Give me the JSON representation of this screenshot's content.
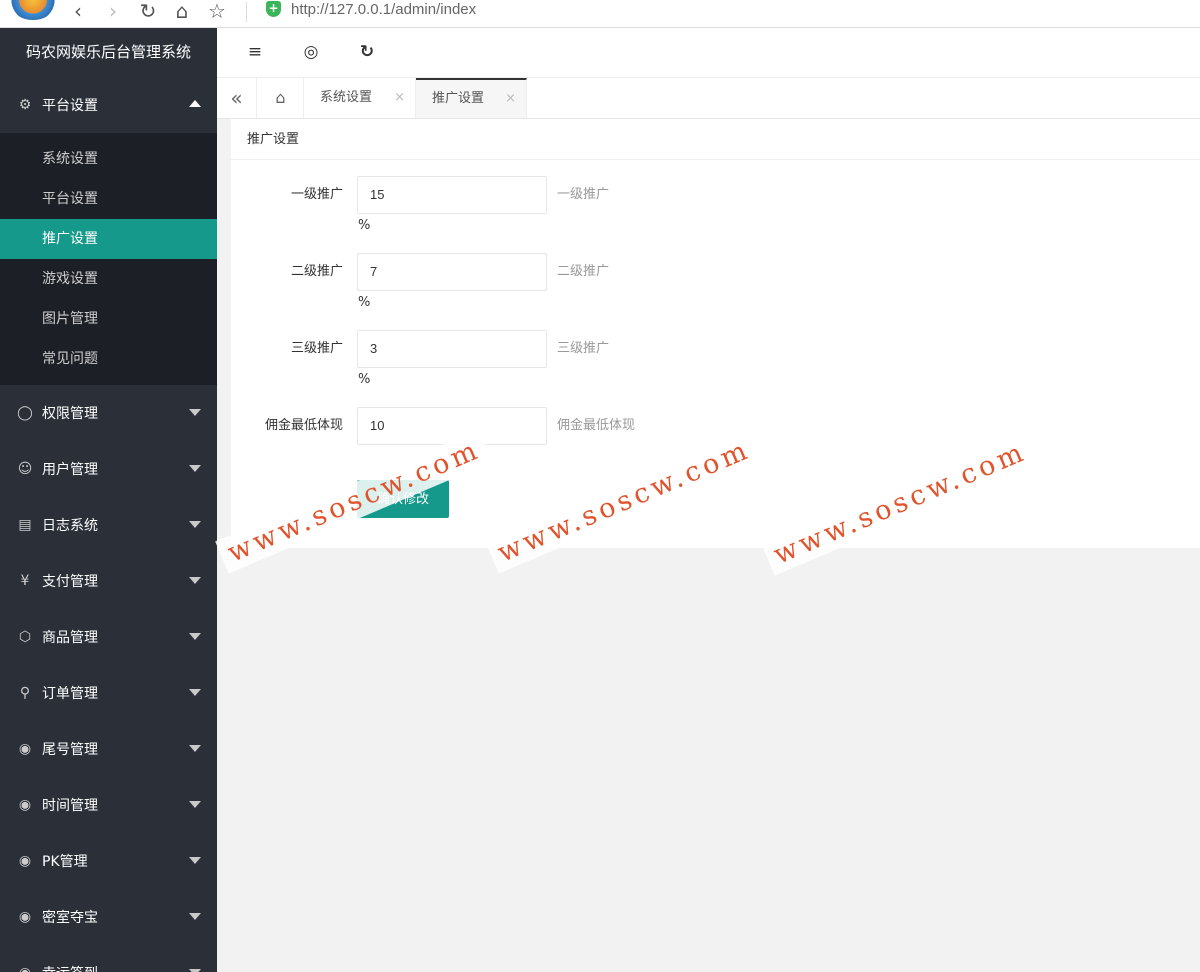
{
  "browser": {
    "url": "http://127.0.0.1/admin/index",
    "icons": [
      "back-icon",
      "forward-icon",
      "reload-icon",
      "home-icon",
      "star-icon",
      "shield-icon"
    ]
  },
  "sidebar": {
    "brand": "码农网娱乐后台管理系统",
    "open_group": {
      "label": "平台设置",
      "icon": "gear-icon",
      "items": [
        {
          "label": "系统设置"
        },
        {
          "label": "平台设置"
        },
        {
          "label": "推广设置",
          "active": true
        },
        {
          "label": "游戏设置"
        },
        {
          "label": "图片管理"
        },
        {
          "label": "常见问题"
        }
      ]
    },
    "groups": [
      {
        "label": "权限管理",
        "icon": "shield-icon"
      },
      {
        "label": "用户管理",
        "icon": "user-icon"
      },
      {
        "label": "日志系统",
        "icon": "log-icon"
      },
      {
        "label": "支付管理",
        "icon": "yen-icon"
      },
      {
        "label": "商品管理",
        "icon": "box-icon"
      },
      {
        "label": "订单管理",
        "icon": "cart-icon"
      },
      {
        "label": "尾号管理",
        "icon": "compass-icon"
      },
      {
        "label": "时间管理",
        "icon": "compass-icon"
      },
      {
        "label": "PK管理",
        "icon": "compass-icon"
      },
      {
        "label": "密室夺宝",
        "icon": "compass-icon"
      },
      {
        "label": "幸运签到",
        "icon": "compass-icon"
      }
    ]
  },
  "header": {
    "icons": [
      "menu-fold-icon",
      "globe-icon",
      "refresh-icon"
    ]
  },
  "tabs": {
    "items": [
      {
        "label": "系统设置",
        "active": false
      },
      {
        "label": "推广设置",
        "active": true
      }
    ],
    "close_glyph": "×"
  },
  "card": {
    "title": "推广设置",
    "fields": [
      {
        "label": "一级推广",
        "value": "15",
        "hint": "一级推广",
        "unit": "%"
      },
      {
        "label": "二级推广",
        "value": "7",
        "hint": "二级推广",
        "unit": "%"
      },
      {
        "label": "三级推广",
        "value": "3",
        "hint": "三级推广",
        "unit": "%"
      },
      {
        "label": "佣金最低体现",
        "value": "10",
        "hint": "佣金最低体现",
        "unit": ""
      }
    ],
    "submit_label": "确认修改"
  },
  "watermark": {
    "text": "www.soscw.com",
    "color": "#e0532b"
  },
  "colors": {
    "accent": "#14998a",
    "sidebar_bg": "#2b2f38",
    "submenu_bg": "#1c1f26"
  }
}
